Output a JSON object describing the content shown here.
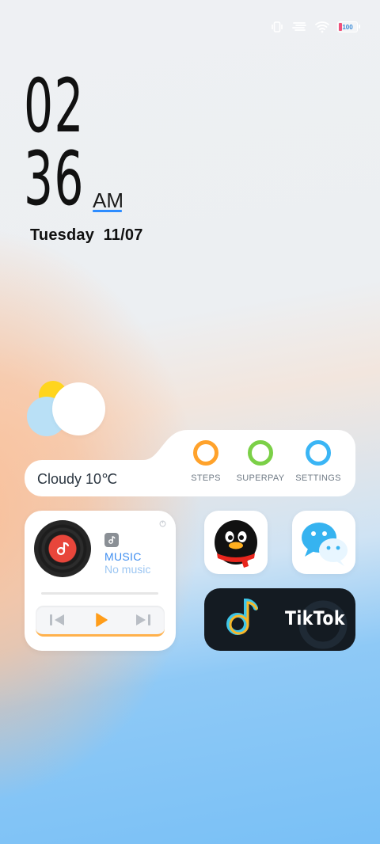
{
  "status_bar": {
    "battery_level": "100",
    "icons": [
      "vibrate-icon",
      "network-speed-icon",
      "wifi-icon",
      "battery-icon"
    ]
  },
  "clock": {
    "hour": "02",
    "minute": "36",
    "ampm": "AM",
    "day": "Tuesday",
    "date": "11/07"
  },
  "weather": {
    "summary": "Cloudy 10℃",
    "icon": "partly-cloudy-icon"
  },
  "quick_actions": [
    {
      "label": "STEPS",
      "color": "#ffa22b"
    },
    {
      "label": "SUPERPAY",
      "color": "#7bd047"
    },
    {
      "label": "SETTINGS",
      "color": "#3ab5f5"
    }
  ],
  "music": {
    "title": "MUSIC",
    "status": "No music",
    "accent": "#3d8df0",
    "controls": [
      "previous-icon",
      "play-icon",
      "next-icon"
    ]
  },
  "apps": {
    "qq": {
      "icon": "qq-penguin-icon"
    },
    "wechat": {
      "icon": "wechat-icon"
    },
    "tiktok": {
      "label": "TikTok"
    }
  }
}
